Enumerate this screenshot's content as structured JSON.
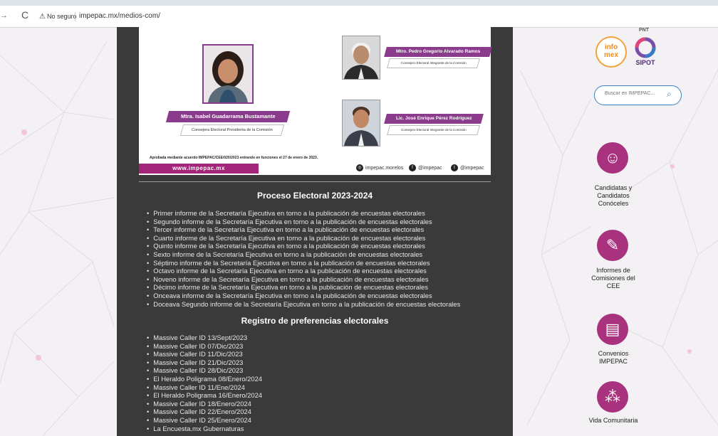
{
  "browser": {
    "back_glyph": "→",
    "reload_glyph": "C",
    "security_label": "No seguro",
    "url": "impepac.mx/medios-com/"
  },
  "banner": {
    "person_left": {
      "name": "Mtra. Isabel Guadarrama Bustamante",
      "role": "Consejera Electoral Presidenta de la Comisión"
    },
    "person_top_right": {
      "name": "Mtro. Pedro Gregorio Alvarado Ramos",
      "role": "Consejero Electoral Integrante de la Comisión"
    },
    "person_bottom_right": {
      "name": "Lic. José Enrique Pérez Rodríguez",
      "role": "Consejero Electoral Integrante de la Comisión"
    },
    "approval_note": "Aprobada mediante acuerdo IMPEPAC/CEE/020/2023 entrando en funciones el 27 de enero de 2023.",
    "site_url": "www.impepac.mx",
    "social": [
      {
        "icon": "instagram-icon",
        "glyph": "◎",
        "label": "impepac.morelos"
      },
      {
        "icon": "facebook-icon",
        "glyph": "f",
        "label": "@impepac"
      },
      {
        "icon": "twitter-icon",
        "glyph": "t",
        "label": "@impepac"
      }
    ]
  },
  "section1": {
    "title": "Proceso Electoral 2023-2024",
    "items": [
      "Primer informe de la Secretaría Ejecutiva en torno a la publicación de encuestas electorales",
      "Segundo informe de la Secretaría Ejecutiva en torno a la publicación de encuestas electorales",
      "Tercer informe de la Secretaría Ejecutiva en torno a la publicación de encuestas electorales",
      "Cuarto informe de la Secretaría Ejecutiva en torno a la publicación de encuestas electorales",
      "Quinto informe de la Secretaría Ejecutiva en torno a la publicación de encuestas electorales",
      "Sexto informe de la Secretaría Ejecutiva en torno a la publicación de encuestas electorales",
      "Séptimo informe de la Secretaría Ejecutiva en torno a la publicación de encuestas electorales",
      "Octavo informe de la Secretaría Ejecutiva en torno a la publicación de encuestas electorales",
      "Noveno informe de la Secretaría Ejecutiva en torno a la publicación de encuestas electorales",
      "Décimo informe de la Secretaría Ejecutiva en torno a la publicación de encuestas electorales",
      "Onceava informe de la Secretaría Ejecutiva en torno a la publicación de encuestas electorales",
      "Doceava Segundo informe de la Secretaría Ejecutiva en torno a la publicación de encuestas electorales"
    ]
  },
  "section2": {
    "title": "Registro de preferencias electorales",
    "items": [
      "Massive Caller ID 13/Sept/2023",
      "Massive Caller ID 07/Dic/2023",
      "Massive Caller ID 11/Dic/2023",
      "Massive Caller ID 21/Dic/2023",
      "Massive Caller ID 28/Dic/2023",
      "El Heraldo Poligrama 08/Enero/2024",
      "Massive Caller ID 11/Ene/2024",
      "El Heraldo Poligrama 16/Enero/2024",
      "Massive Caller ID 18/Enero/2024",
      "Massive Caller ID 22/Enero/2024",
      "Massive Caller ID 25/Enero/2024",
      "La Encuesta.mx Gubernaturas"
    ]
  },
  "sidebar": {
    "infomex_line1": "info",
    "infomex_line2": "mex",
    "pnt_label": "PNT",
    "sipot_label": "SIPOT",
    "search_placeholder": "Buscar en IMPEPAC...",
    "links": [
      {
        "label": "Candidatas y Candidatos Conóceles",
        "icon": "candidates-icon",
        "glyph": "☺"
      },
      {
        "label": "Informes de Comisiones del CEE",
        "icon": "report-edit-icon",
        "glyph": "✎"
      },
      {
        "label": "Convenios IMPEPAC",
        "icon": "document-icon",
        "glyph": "▤"
      },
      {
        "label": "Vida Comunitaria",
        "icon": "community-icon",
        "glyph": "⁂"
      }
    ]
  },
  "colors": {
    "brand_magenta": "#a8327e",
    "nameplate_purple": "#8a3b8b",
    "content_bg": "#3a3a3a",
    "search_blue": "#3b83c4"
  }
}
